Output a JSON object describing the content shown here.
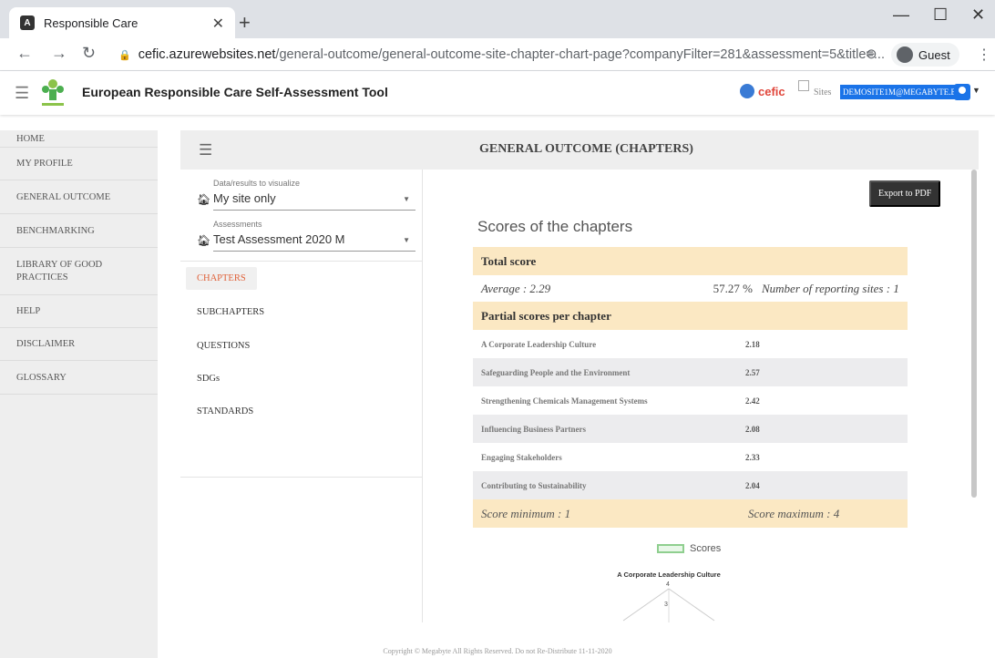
{
  "browser": {
    "tab_title": "Responsible Care",
    "url_host": "cefic.azurewebsites.net",
    "url_path": "/general-outcome/general-outcome-site-chapter-chart-page?companyFilter=281&assessment=5&title=...",
    "profile": "Guest"
  },
  "header": {
    "app_title": "European Responsible Care Self-Assessment Tool",
    "brand": "cefic",
    "sites_label": "Sites",
    "user": "DEMOSITE1M@MEGABYTE.BE"
  },
  "sidebar": {
    "items": [
      {
        "label": "HOME"
      },
      {
        "label": "MY PROFILE"
      },
      {
        "label": "GENERAL OUTCOME"
      },
      {
        "label": "BENCHMARKING"
      },
      {
        "label": "LIBRARY OF GOOD PRACTICES"
      },
      {
        "label": "HELP"
      },
      {
        "label": "DISCLAIMER"
      },
      {
        "label": "GLOSSARY"
      }
    ]
  },
  "page": {
    "title": "GENERAL OUTCOME (CHAPTERS)",
    "filter1_label": "Data/results to visualize",
    "filter1_value": "My site only",
    "filter2_label": "Assessments",
    "filter2_value": "Test Assessment 2020 M",
    "nav": [
      "CHAPTERS",
      "SUBCHAPTERS",
      "QUESTIONS",
      "SDGs",
      "STANDARDS"
    ],
    "export_label": "Export to PDF",
    "scores_title": "Scores of the chapters",
    "total_score_label": "Total score",
    "average": "Average : 2.29",
    "percent": "57.27 %",
    "reporting_sites": "Number of reporting sites : 1",
    "partial_label": "Partial scores per chapter",
    "chapters": [
      {
        "name": "A Corporate Leadership Culture",
        "score": "2.18"
      },
      {
        "name": "Safeguarding People and the Environment",
        "score": "2.57"
      },
      {
        "name": "Strengthening Chemicals Management Systems",
        "score": "2.42"
      },
      {
        "name": "Influencing Business Partners",
        "score": "2.08"
      },
      {
        "name": "Engaging Stakeholders",
        "score": "2.33"
      },
      {
        "name": "Contributing to Sustainability",
        "score": "2.04"
      }
    ],
    "score_min": "Score minimum : 1",
    "score_max": "Score maximum : 4",
    "legend": "Scores",
    "chart_axis_label": "A Corporate Leadership Culture",
    "chart_tick_4": "4",
    "chart_tick_3": "3",
    "footer": "Copyright © Megabyte All Rights Reserved. Do not Re-Distribute 11-11-2020"
  }
}
